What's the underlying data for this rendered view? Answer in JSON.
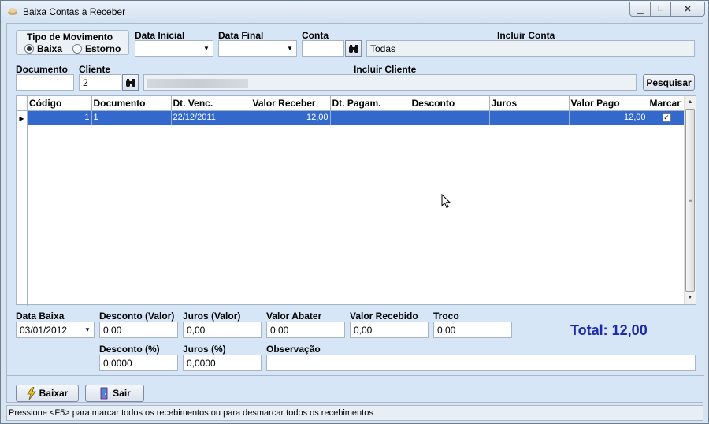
{
  "window": {
    "title": "Baixa Contas à Receber"
  },
  "filters": {
    "tipo_movimento_label": "Tipo de Movimento",
    "radio_baixa": "Baixa",
    "radio_estorno": "Estorno",
    "data_inicial_label": "Data Inicial",
    "data_inicial_value": "",
    "data_final_label": "Data Final",
    "data_final_value": "",
    "conta_label": "Conta",
    "conta_value": "",
    "incluir_conta_label": "Incluir Conta",
    "incluir_conta_value": "Todas",
    "documento_label": "Documento",
    "documento_value": "",
    "cliente_label": "Cliente",
    "cliente_value": "2",
    "incluir_cliente_label": "Incluir Cliente",
    "pesquisar_label": "Pesquisar"
  },
  "grid": {
    "columns": [
      "Código",
      "Documento",
      "Dt. Venc.",
      "Valor Receber",
      "Dt. Pagam.",
      "Desconto",
      "Juros",
      "Valor Pago",
      "Marcar"
    ],
    "rows": [
      {
        "codigo": "1",
        "documento": "1",
        "dt_venc": "22/12/2011",
        "valor_receber": "12,00",
        "dt_pagam": "",
        "desconto": "",
        "juros": "",
        "valor_pago": "12,00",
        "marcar": true
      }
    ]
  },
  "bottom": {
    "data_baixa_label": "Data Baixa",
    "data_baixa_value": "03/01/2012",
    "desconto_valor_label": "Desconto (Valor)",
    "desconto_valor_value": "0,00",
    "juros_valor_label": "Juros (Valor)",
    "juros_valor_value": "0,00",
    "valor_abater_label": "Valor Abater",
    "valor_abater_value": "0,00",
    "valor_recebido_label": "Valor Recebido",
    "valor_recebido_value": "0,00",
    "troco_label": "Troco",
    "troco_value": "0,00",
    "total_text": "Total: 12,00",
    "desconto_pct_label": "Desconto (%)",
    "desconto_pct_value": "0,0000",
    "juros_pct_label": "Juros (%)",
    "juros_pct_value": "0,0000",
    "observacao_label": "Observação",
    "observacao_value": ""
  },
  "actions": {
    "baixar_label": "Baixar",
    "sair_label": "Sair"
  },
  "status": {
    "text": "Pressione <F5> para marcar todos os recebimentos ou para desmarcar todos os recebimentos"
  },
  "colors": {
    "accent": "#1a2aa8",
    "selection": "#3368cc",
    "background": "#d6e6f6"
  },
  "icons": {
    "search": "binoculars-icon",
    "baixar": "lightning-icon",
    "sair": "exit-door-icon"
  }
}
